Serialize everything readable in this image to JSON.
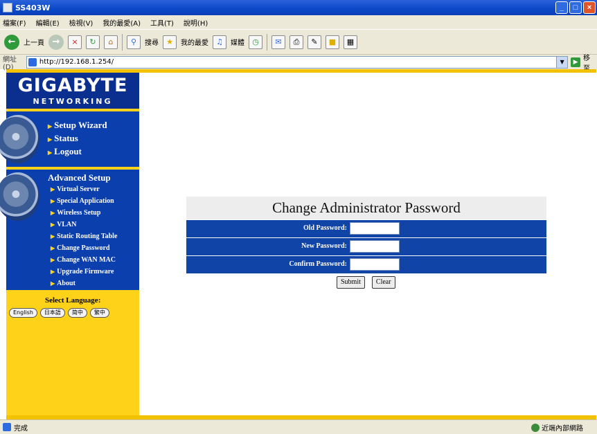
{
  "window": {
    "title": "SS403W"
  },
  "menu": {
    "items": [
      "檔案(F)",
      "編輯(E)",
      "檢視(V)",
      "我的最愛(A)",
      "工具(T)",
      "說明(H)"
    ]
  },
  "toolbar": {
    "back_label": "上一頁",
    "search_label": "搜尋",
    "favorites_label": "我的最愛",
    "media_label": "媒體"
  },
  "address": {
    "label": "網址(D)",
    "url": "http://192.168.1.254/",
    "go_label": "移至"
  },
  "sidebar": {
    "logo": {
      "brand": "GIGABYTE",
      "sub": "NETWORKING"
    },
    "main_links": [
      "Setup Wizard",
      "Status",
      "Logout"
    ],
    "advanced_title": "Advanced Setup",
    "advanced_links": [
      "Virtual Server",
      "Special Application",
      "Wireless Setup",
      "VLAN",
      "Static Routing Table",
      "Change Password",
      "Change WAN MAC",
      "Upgrade Firmware",
      "About"
    ],
    "language_title": "Select Language:",
    "languages": [
      "English",
      "日本語",
      "简中",
      "繁中"
    ]
  },
  "form": {
    "title": "Change Administrator Password",
    "fields": [
      {
        "label": "Old Password:",
        "value": ""
      },
      {
        "label": "New Password:",
        "value": ""
      },
      {
        "label": "Confirm Password:",
        "value": ""
      }
    ],
    "submit_label": "Submit",
    "clear_label": "Clear"
  },
  "status": {
    "text": "完成",
    "zone": "近端內部網路"
  },
  "colors": {
    "nav_blue": "#0b3fae",
    "accent_yellow": "#ffd21a",
    "form_blue": "#1044a7"
  }
}
